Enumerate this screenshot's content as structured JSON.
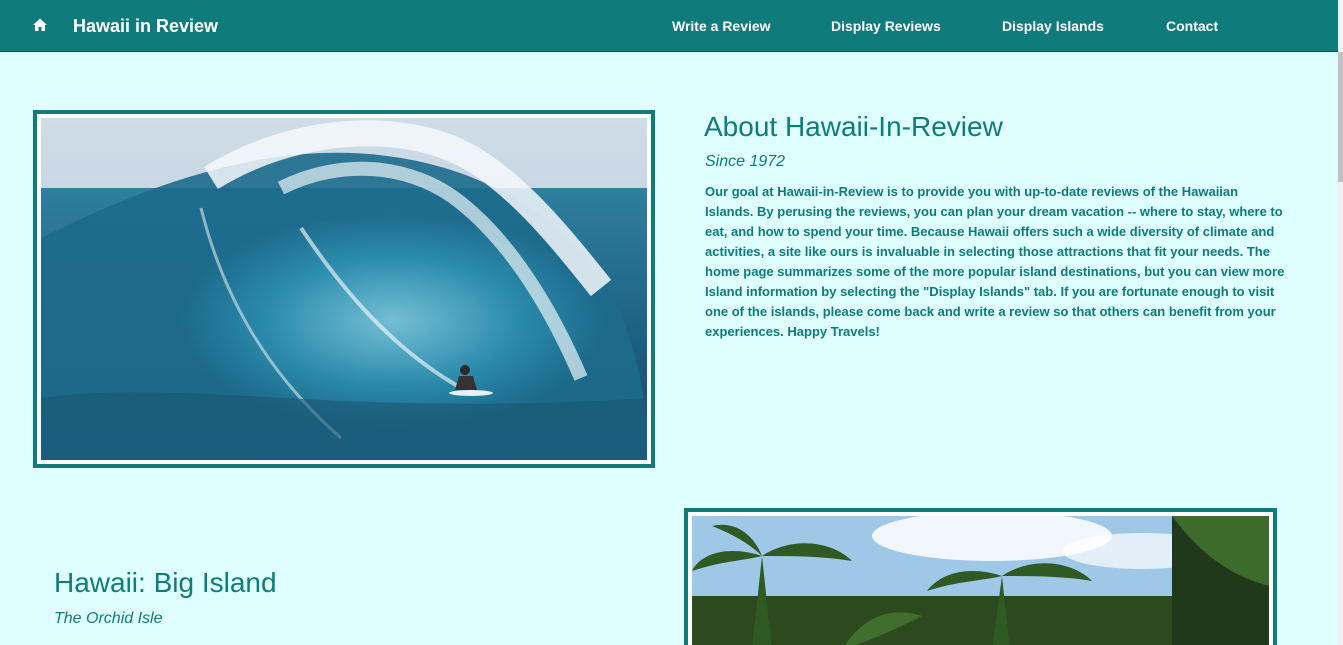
{
  "nav": {
    "home_icon": "home-icon",
    "brand": "Hawaii in Review",
    "links": [
      "Write a Review",
      "Display Reviews",
      "Display Islands",
      "Contact"
    ]
  },
  "about": {
    "title": "About Hawaii-In-Review",
    "subtitle": "Since 1972",
    "body": "Our goal at Hawaii-in-Review is to provide you with up-to-date reviews of the Hawaiian Islands. By perusing the reviews, you can plan your dream vacation -- where to stay, where to eat, and how to spend your time. Because Hawaii offers such a wide diversity of climate and activities, a site like ours is invaluable in selecting those attractions that fit your needs. The home page summarizes some of the more popular island destinations, but you can view more Island information by selecting the \"Display Islands\" tab. If you are fortunate enough to visit one of the islands, please come back and write a review so that others can benefit from your experiences. Happy Travels!"
  },
  "island": {
    "title": "Hawaii: Big Island",
    "subtitle": "The Orchid Isle"
  },
  "colors": {
    "accent": "#0f7b7b",
    "background": "#dfffff",
    "nav_text": "#ffffff"
  }
}
